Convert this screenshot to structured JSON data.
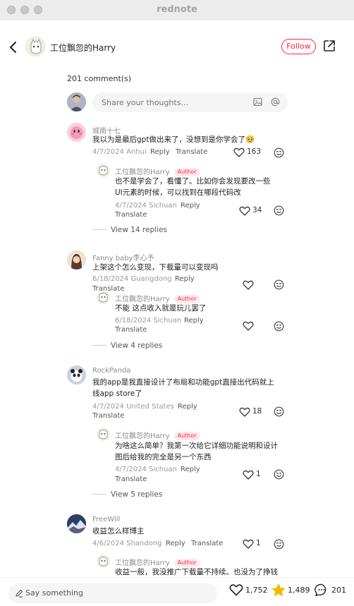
{
  "window": {
    "title": "rednote"
  },
  "header": {
    "author_name": "工位飘忽的Harry",
    "follow_label": "Follow"
  },
  "comments_count": "201 comment(s)",
  "input": {
    "placeholder": "Share your thoughts..."
  },
  "author_badge": "Author",
  "actions": {
    "reply": "Reply",
    "translate": "Translate"
  },
  "comments": [
    {
      "name": "城南十七",
      "text": "我以为是最后gpt做出来了，没想到是你学会了🥹",
      "date": "4/7/2024 Anhui",
      "likes": "163"
    },
    {
      "name": "工位飘忽的Harry",
      "text": "也不是学会了，看懂了。比如你会发现要改一些\nUI元素的时候，可以找到在哪段代码改",
      "date": "4/7/2024 Sichuan",
      "likes": "34"
    },
    {
      "view": "View 14 replies"
    },
    {
      "name": "Fanny baby李心予",
      "text": "上架这个怎么变现，下载量可以变现吗",
      "date": "6/18/2024 Guangdong",
      "likes": ""
    },
    {
      "name": "工位飘忽的Harry",
      "text": "不能  这点收入就是玩儿罢了",
      "date": "6/18/2024 Sichuan",
      "likes": ""
    },
    {
      "view": "View 4 replies"
    },
    {
      "name": "RockPanda",
      "text": "我的app是我直接设计了布局和功能gpt直接出代码就上\n线app store了",
      "date": "4/7/2024 United States",
      "likes": "18"
    },
    {
      "name": "工位飘忽的Harry",
      "text": "为啥这么简单？我第一次给它详细功能说明和设计\n图后给我的完全是另一个东西",
      "date": "4/7/2024 Sichuan",
      "likes": "1"
    },
    {
      "view": "View 5 replies"
    },
    {
      "name": "FreeWill",
      "text": "收益怎么样博主",
      "date": "4/6/2024 Shandong",
      "likes": "1"
    },
    {
      "name": "工位飘忽的Harry",
      "text": "收益一般，我没推广下载量不持续。也没为了挣钱",
      "date": "",
      "likes": ""
    }
  ],
  "bottom": {
    "say_label": "Say something",
    "likes": "1,752",
    "favorites": "1,489",
    "comments": "201"
  },
  "colors": {
    "accent": "#ff2442",
    "star": "#f5b800"
  }
}
